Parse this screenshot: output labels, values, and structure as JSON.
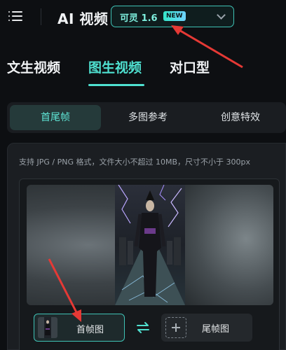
{
  "header": {
    "app_title": "AI 视频",
    "model": {
      "name": "可灵 1.6",
      "badge": "NEW"
    }
  },
  "main_tabs": [
    {
      "label": "文生视频",
      "active": false
    },
    {
      "label": "图生视频",
      "active": true
    },
    {
      "label": "对口型",
      "active": false
    }
  ],
  "sub_tabs": [
    {
      "label": "首尾帧",
      "active": true
    },
    {
      "label": "多图参考",
      "active": false
    },
    {
      "label": "创意特效",
      "active": false
    }
  ],
  "upload": {
    "hint": "支持 JPG / PNG 格式，文件大小不超过 10MB，尺寸不小于 300px",
    "first_frame_label": "首帧图",
    "last_frame_label": "尾帧图"
  },
  "colors": {
    "accent": "#4fe0d0",
    "annotation_arrow": "#e53935",
    "background": "#0d0f12"
  },
  "icons": [
    "menu-icon",
    "chevron-down-icon",
    "swap-icon",
    "plus-icon"
  ]
}
